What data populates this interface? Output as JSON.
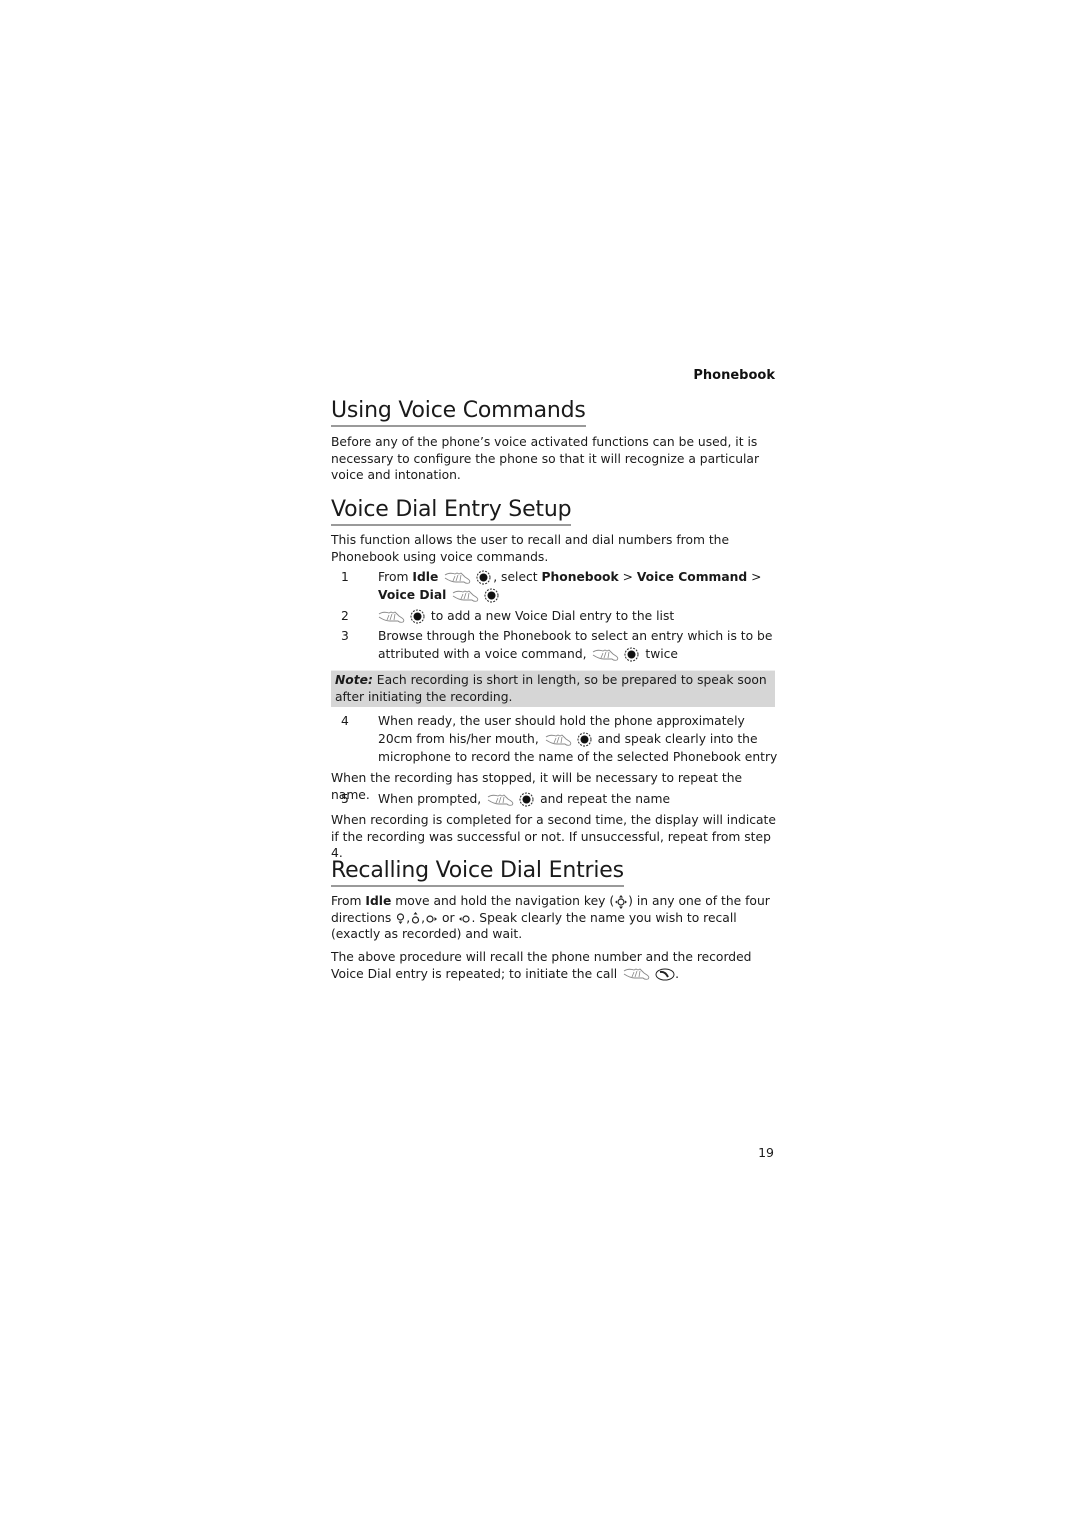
{
  "running_head": "Phonebook",
  "sections": [
    {
      "heading": "Using Voice Commands",
      "paragraph": "Before any of the phone’s voice activated functions can be used, it is necessary to configure the phone so that it will recognize a particular voice and intonation."
    },
    {
      "heading": "Voice Dial Entry Setup",
      "paragraph": "This function allows the user to recall and dial numbers from the Phonebook using voice commands.",
      "steps": [
        {
          "num": "1",
          "from": "From ",
          "idle": "Idle",
          "select": ", select ",
          "phonebook": "Phonebook",
          "gt1": " > ",
          "voice_command": "Voice Command",
          "gt2": " >",
          "voice_dial": "Voice Dial"
        },
        {
          "num": "2",
          "text": "to add a new Voice Dial entry to the list"
        },
        {
          "num": "3",
          "text_a": "Browse through the Phonebook to select an entry which is to be attributed with a voice command,",
          "text_b": "twice"
        },
        {
          "num": "4",
          "text_a": "When ready, the user should hold the phone approximately 20cm from his/her mouth,",
          "text_b": "and speak clearly into the microphone to record the name of the selected Phonebook entry"
        },
        {
          "num": "5",
          "text_a": "When prompted,",
          "text_b": "and repeat the name"
        }
      ],
      "note": {
        "label": "Note:",
        "text": " Each recording is short in length, so be prepared to speak soon after initiating the recording."
      },
      "after_step4": "When the recording has stopped, it will be necessary to repeat the name.",
      "after_step5": "When recording is completed for a second time, the display will indicate if the recording was successful or not. If unsuccessful, repeat from step 4."
    },
    {
      "heading": "Recalling Voice Dial Entries",
      "p1": {
        "from": "From ",
        "idle": "Idle",
        "a": " move and hold the navigation key (",
        "b": ") in any one of the four directions ",
        "c": " or ",
        "d": ". Speak clearly the name you wish to recall (exactly as recorded) and wait."
      },
      "p2": "The above procedure will recall the phone number and the recorded Voice Dial entry is repeated; to initiate the call",
      "p2_end": "."
    }
  ],
  "icons": {
    "press": "hand-press-icon",
    "ok": "ok-key-icon",
    "nav": "navigation-key-icon",
    "call": "call-key-icon"
  },
  "page_number": "19"
}
